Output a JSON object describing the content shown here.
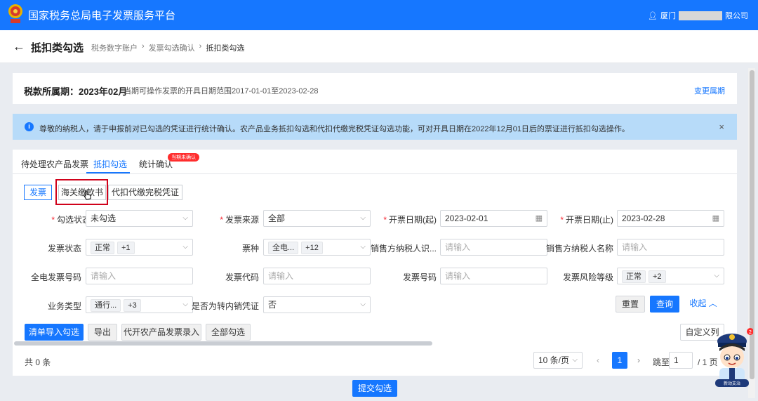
{
  "header": {
    "title": "国家税务总局电子发票服务平台",
    "user_prefix": "厦门",
    "user_suffix": "限公司"
  },
  "subheader": {
    "back_icon": "arrow-left-icon",
    "title": "抵扣类勾选",
    "breadcrumbs": [
      "税务数字账户",
      "发票勾选确认",
      "抵扣类勾选"
    ]
  },
  "period": {
    "label": "税款所属期：2023年02月",
    "range_text": "当期可操作发票的开具日期范围2017-01-01至2023-02-28",
    "change_link": "变更属期"
  },
  "notice": {
    "text": "尊敬的纳税人，请于申报前对已勾选的凭证进行统计确认。农产品业务抵扣勾选和代扣代缴完税凭证勾选功能，可对开具日期在2022年12月01日后的票证进行抵扣勾选操作。",
    "close": "×"
  },
  "tabs": [
    {
      "label": "待处理农产品发票"
    },
    {
      "label": "抵扣勾选"
    },
    {
      "label": "统计确认"
    }
  ],
  "tab_badge": "当期未确认",
  "segments": [
    {
      "label": "发票"
    },
    {
      "label": "海关缴款书"
    },
    {
      "label": "代扣代缴完税凭证"
    }
  ],
  "filters": {
    "check_status": {
      "label": "勾选状态",
      "value": "未勾选"
    },
    "invoice_source": {
      "label": "发票来源",
      "value": "全部"
    },
    "date_start": {
      "label": "开票日期(起)",
      "value": "2023-02-01"
    },
    "date_end": {
      "label": "开票日期(止)",
      "value": "2023-02-28"
    },
    "invoice_status": {
      "label": "发票状态",
      "tag": "正常",
      "more": "+1"
    },
    "ticket_type": {
      "label": "票种",
      "tag": "全电...",
      "more": "+12"
    },
    "seller_tax_id": {
      "label": "销售方纳税人识...",
      "placeholder": "请输入"
    },
    "seller_name": {
      "label": "销售方纳税人名称",
      "placeholder": "请输入"
    },
    "full_invoice_no": {
      "label": "全电发票号码",
      "placeholder": "请输入"
    },
    "invoice_code": {
      "label": "发票代码",
      "placeholder": "请输入"
    },
    "invoice_no": {
      "label": "发票号码",
      "placeholder": "请输入"
    },
    "risk_level": {
      "label": "发票风险等级",
      "tag": "正常",
      "more": "+2"
    },
    "business_type": {
      "label": "业务类型",
      "tag": "通行...",
      "more": "+3"
    },
    "transfer_out": {
      "label": "是否为转内销凭证",
      "value": "否"
    }
  },
  "actions": {
    "reset": "重置",
    "query": "查询",
    "collapse": "收起"
  },
  "toolbar": {
    "import": "清单导入勾选",
    "export": "导出",
    "agri_entry": "代开农产品发票录入",
    "select_all": "全部勾选",
    "custom_columns": "自定义列"
  },
  "pagination": {
    "total": "共 0 条",
    "page_size": "10 条/页",
    "current_page": "1",
    "jump_label": "跳至",
    "jump_value": "1",
    "page_total": "/ 1 页"
  },
  "submit": "提交勾选",
  "mascot": {
    "label": "新动支治",
    "badge": "2"
  }
}
